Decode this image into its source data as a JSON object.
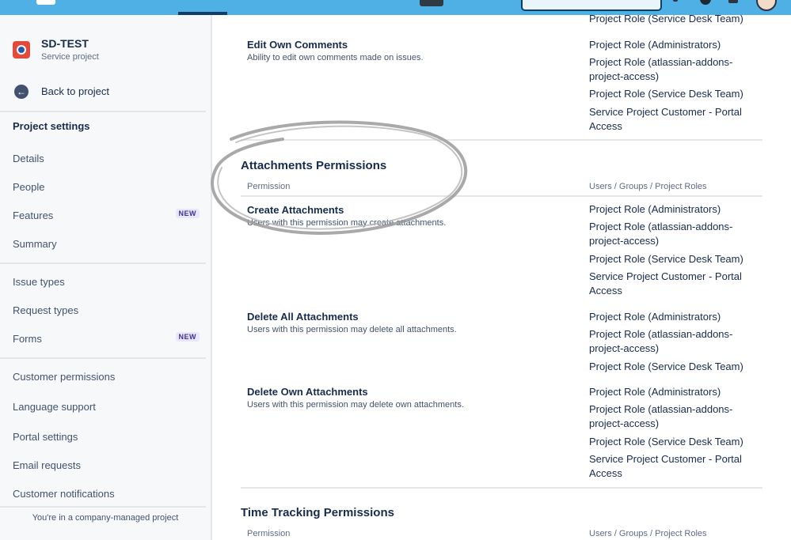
{
  "sidebar": {
    "project_name": "SD-TEST",
    "project_type": "Service project",
    "back_label": "Back to project",
    "settings_heading": "Project settings",
    "items": [
      {
        "label": "Details"
      },
      {
        "label": "People"
      },
      {
        "label": "Features",
        "badge": "NEW"
      },
      {
        "label": "Summary"
      },
      {
        "label": "Issue types"
      },
      {
        "label": "Request types"
      },
      {
        "label": "Forms",
        "badge": "NEW"
      },
      {
        "label": "Customer permissions"
      },
      {
        "label": "Language support"
      },
      {
        "label": "Portal settings"
      },
      {
        "label": "Email requests"
      },
      {
        "label": "Customer notifications"
      }
    ],
    "footer": "You're in a company-managed project"
  },
  "main": {
    "top_partial_grantee": "Project Role (Service Desk Team)",
    "edit_own_comments": {
      "title": "Edit Own Comments",
      "desc": "Ability to edit own comments made on issues.",
      "grantees": [
        "Project Role (Administrators)",
        "Project Role (atlassian-addons-project-access)",
        "Project Role (Service Desk Team)",
        "Service Project Customer - Portal Access"
      ]
    },
    "attachments": {
      "title": "Attachments Permissions",
      "col_permission": "Permission",
      "col_users": "Users / Groups / Project Roles",
      "create": {
        "title": "Create Attachments",
        "desc": "Users with this permission may create attachments.",
        "grantees": [
          "Project Role (Administrators)",
          "Project Role (atlassian-addons-project-access)",
          "Project Role (Service Desk Team)",
          "Service Project Customer - Portal Access"
        ]
      },
      "delete_all": {
        "title": "Delete All Attachments",
        "desc": "Users with this permission may delete all attachments.",
        "grantees": [
          "Project Role (Administrators)",
          "Project Role (atlassian-addons-project-access)",
          "Project Role (Service Desk Team)"
        ]
      },
      "delete_own": {
        "title": "Delete Own Attachments",
        "desc": "Users with this permission may delete own attachments.",
        "grantees": [
          "Project Role (Administrators)",
          "Project Role (atlassian-addons-project-access)",
          "Project Role (Service Desk Team)",
          "Service Project Customer - Portal Access"
        ]
      }
    },
    "time_tracking": {
      "title": "Time Tracking Permissions",
      "col_permission": "Permission",
      "col_users": "Users / Groups / Project Roles"
    }
  },
  "colors": {
    "topbar": "#4fb0e6",
    "annotation": "#9a9a9a"
  }
}
